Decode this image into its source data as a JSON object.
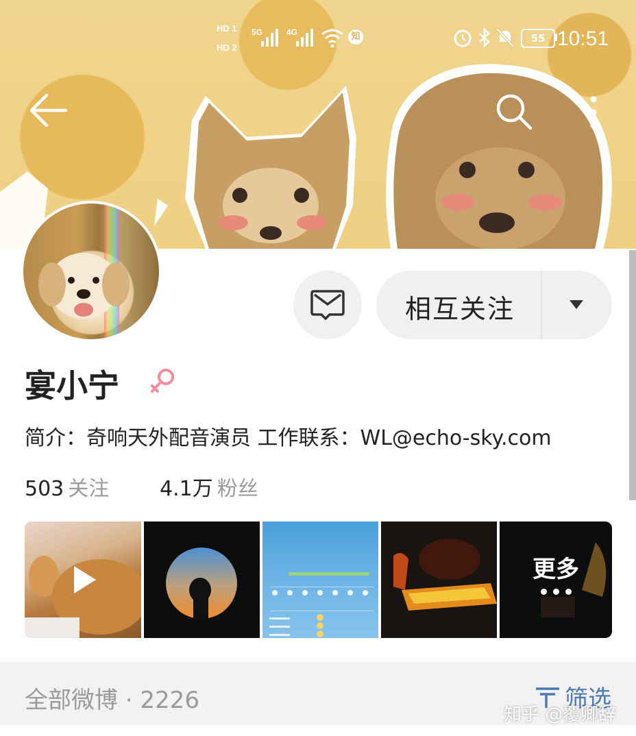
{
  "status_bar": {
    "sim1": "HD 1",
    "sim2": "HD 2",
    "net1": "5G",
    "net2": "4G",
    "zhi_badge": "知",
    "battery": "55",
    "time": "10:51"
  },
  "nav": {
    "back_icon": "arrow-left",
    "search_icon": "magnifier",
    "more_icon": "vertical-ellipsis"
  },
  "profile": {
    "name": "宴小宁",
    "gender_icon": "female-symbol",
    "gender_color": "#f28b9b",
    "bio": "简介：奇响天外配音演员 工作联系：WL@echo-sky.com",
    "following_count": "503",
    "following_label": "关注",
    "followers_count": "4.1万",
    "followers_label": "粉丝"
  },
  "actions": {
    "message_icon": "envelope",
    "follow_label": "相互关注",
    "follow_dropdown_icon": "caret-down"
  },
  "media": {
    "items": [
      {
        "kind": "video",
        "icon": "play"
      },
      {
        "kind": "photo"
      },
      {
        "kind": "photo"
      },
      {
        "kind": "photo"
      },
      {
        "kind": "photo"
      }
    ],
    "more_label": "更多"
  },
  "feed": {
    "all_label": "全部微博 · 2226",
    "filter_label": "筛选",
    "filter_icon": "filter",
    "accent": "#4a7bb7"
  },
  "watermark": "知乎 @覆卿辞"
}
